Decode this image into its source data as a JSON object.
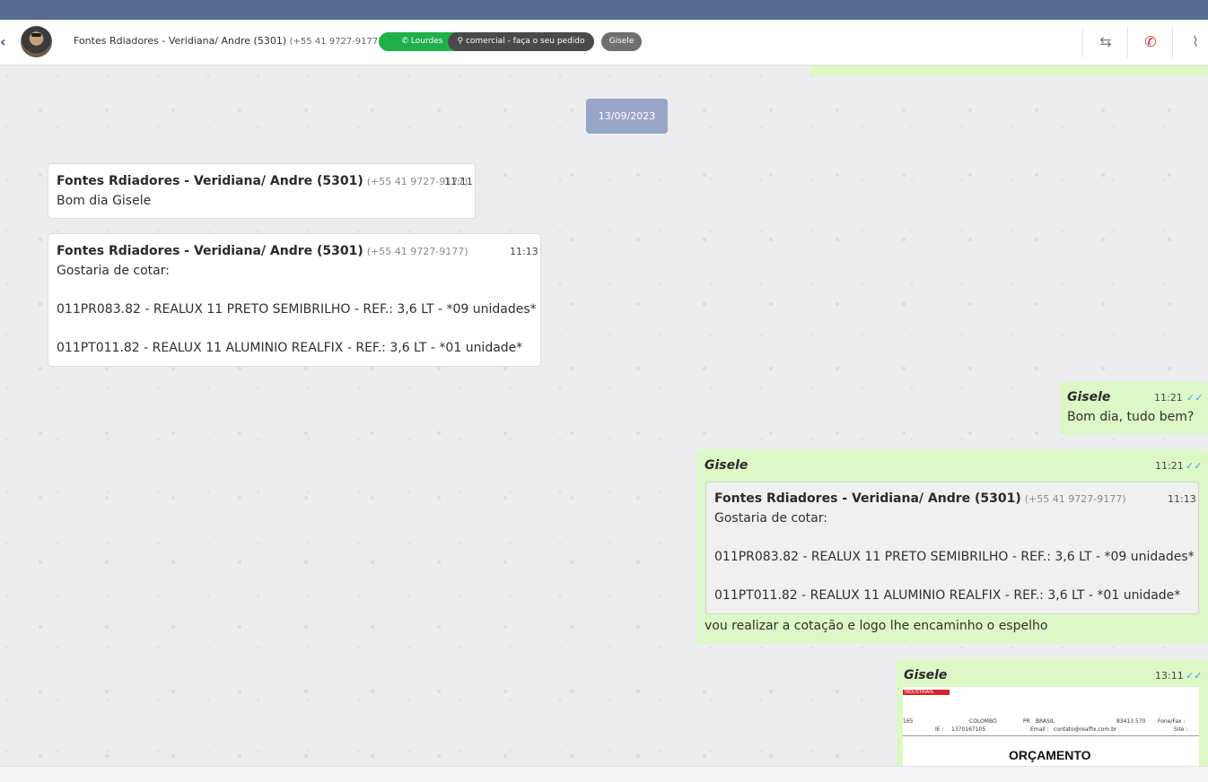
{
  "header": {
    "contact_name": "Fontes Rdiadores - Veridiana/ Andre (5301)",
    "contact_phone": "(+55 41 9727-9177)",
    "tag_whatsapp": "Lourdes",
    "tag_department": "comercial - faça o seu pedido",
    "tag_user": "Gisele"
  },
  "icons": {
    "back": "chevron-left-icon",
    "whatsapp": "whatsapp-icon",
    "department": "sitemap-icon",
    "transfer": "transfer-icon",
    "hangup": "phone-hangup-icon",
    "attach": "paperclip-icon"
  },
  "colors": {
    "topbar": "#56698f",
    "incoming": "#ffffff",
    "outgoing": "#dcf8c6",
    "whatsapp_tag": "#20b04a",
    "hangup": "#d6252e",
    "date_pill": "#9aa6c8",
    "read_ticks": "#4a9de0"
  },
  "chat": {
    "date_separator": "13/09/2023",
    "messages": [
      {
        "sender": "Fontes Rdiadores - Veridiana/ Andre (5301)",
        "phone": "(+55 41 9727-9177)",
        "time": "11:11",
        "text": "Bom dia Gisele"
      },
      {
        "sender": "Fontes Rdiadores - Veridiana/ Andre (5301)",
        "phone": "(+55 41 9727-9177)",
        "time": "11:13",
        "lines": [
          "Gostaria de cotar:",
          "011PR083.82 - REALUX 11 PRETO SEMIBRILHO - REF.: 3,6 LT - *09 unidades*",
          "011PT011.82 - REALUX 11 ALUMINIO REALFIX - REF.: 3,6 LT - *01 unidade*"
        ]
      },
      {
        "sender": "Gisele",
        "time": "11:21",
        "ticks": "✓✓",
        "text": "Bom dia, tudo bem?"
      },
      {
        "sender": "Gisele",
        "time": "11:21",
        "ticks": "✓✓",
        "quote": {
          "sender": "Fontes Rdiadores - Veridiana/ Andre (5301)",
          "phone": "(+55 41 9727-9177)",
          "time": "11:13",
          "lines": [
            "Gostaria de cotar:",
            "011PR083.82 - REALUX 11 PRETO SEMIBRILHO - REF.: 3,6 LT - *09 unidades*",
            "011PT011.82 - REALUX 11 ALUMINIO REALFIX - REF.: 3,6 LT - *01 unidade*"
          ]
        },
        "text": "vou realizar a cotação e logo lhe encaminho o espelho"
      },
      {
        "sender": "Gisele",
        "time": "13:11",
        "ticks": "✓✓",
        "document": {
          "company_tag": "INDUSTRIAIS",
          "row1": [
            "165",
            "COLOMBO",
            "PR",
            "BRASIL",
            "83413.570",
            "Fone/Fax :"
          ],
          "row2": [
            "IE :",
            "1370167105",
            "Email :",
            "contato@realfix.com.br",
            "Site :"
          ],
          "title": "ORÇAMENTO"
        }
      }
    ]
  }
}
